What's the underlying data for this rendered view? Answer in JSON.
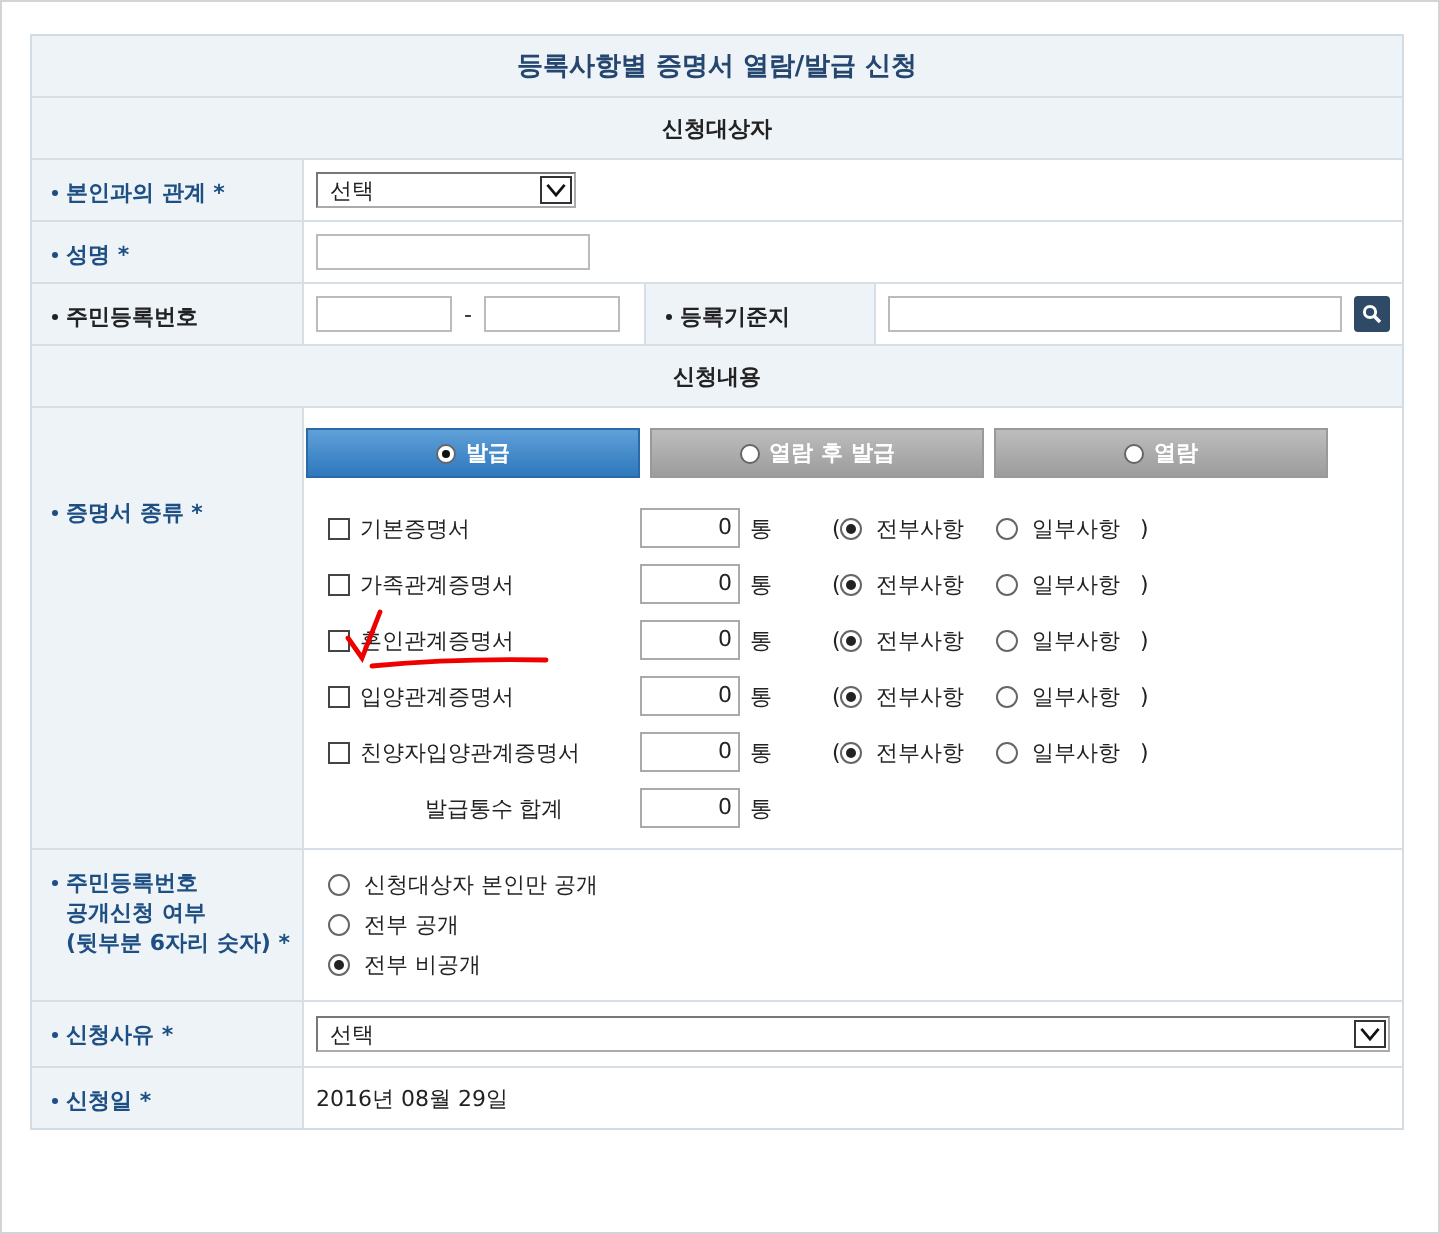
{
  "title": "등록사항별 증명서 열람/발급 신청",
  "applicant": {
    "header": "신청대상자",
    "relation": {
      "label": "본인과의 관계 *",
      "required": true,
      "value": "선택"
    },
    "name": {
      "label": "성명 *",
      "required": true
    },
    "resident_number": {
      "label": "주민등록번호",
      "required": false,
      "separator": "-"
    },
    "registry_base": {
      "label": "등록기준지",
      "required": false
    }
  },
  "request": {
    "header": "신청내용",
    "tabs": [
      {
        "label": "발급",
        "selected": true
      },
      {
        "label": "열람 후 발급",
        "selected": false
      },
      {
        "label": "열람",
        "selected": false
      }
    ],
    "certificates": {
      "label": "증명서 종류 *",
      "required": true,
      "items": [
        {
          "name": "기본증명서",
          "checked": false,
          "highlighted": false,
          "count": "0",
          "unit": "통",
          "open": "(",
          "close": ")",
          "scope": [
            {
              "label": "전부사항",
              "selected": true
            },
            {
              "label": "일부사항",
              "selected": false
            }
          ]
        },
        {
          "name": "가족관계증명서",
          "checked": false,
          "highlighted": false,
          "count": "0",
          "unit": "통",
          "open": "(",
          "close": ")",
          "scope": [
            {
              "label": "전부사항",
              "selected": true
            },
            {
              "label": "일부사항",
              "selected": false
            }
          ]
        },
        {
          "name": "혼인관계증명서",
          "checked": false,
          "highlighted": true,
          "count": "0",
          "unit": "통",
          "open": "(",
          "close": ")",
          "scope": [
            {
              "label": "전부사항",
              "selected": true
            },
            {
              "label": "일부사항",
              "selected": false
            }
          ]
        },
        {
          "name": "입양관계증명서",
          "checked": false,
          "highlighted": false,
          "count": "0",
          "unit": "통",
          "open": "(",
          "close": ")",
          "scope": [
            {
              "label": "전부사항",
              "selected": true
            },
            {
              "label": "일부사항",
              "selected": false
            }
          ]
        },
        {
          "name": "친양자입양관계증명서",
          "checked": false,
          "highlighted": false,
          "count": "0",
          "unit": "통",
          "open": "(",
          "close": ")",
          "scope": [
            {
              "label": "전부사항",
              "selected": true
            },
            {
              "label": "일부사항",
              "selected": false
            }
          ]
        }
      ],
      "total": {
        "label": "발급통수 합계",
        "count": "0",
        "unit": "통"
      }
    },
    "disclosure": {
      "label_lines": [
        "주민등록번호",
        "공개신청 여부",
        "(뒷부분 6자리 숫자) *"
      ],
      "required": true,
      "options": [
        {
          "label": "신청대상자 본인만 공개",
          "selected": false
        },
        {
          "label": "전부 공개",
          "selected": false
        },
        {
          "label": "전부 비공개",
          "selected": true
        }
      ]
    },
    "reason": {
      "label": "신청사유 *",
      "required": true,
      "value": "선택"
    },
    "date": {
      "label": "신청일 *",
      "required": true,
      "value": "2016년 08월 29일"
    }
  }
}
